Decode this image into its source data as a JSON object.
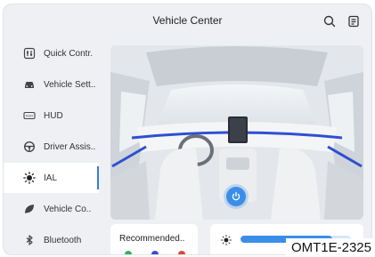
{
  "header": {
    "title": "Vehicle Center"
  },
  "sidebar": {
    "items": [
      {
        "label": "Quick Contr.",
        "icon": "quick-control-icon"
      },
      {
        "label": "Vehicle Sett..",
        "icon": "car-icon"
      },
      {
        "label": "HUD",
        "icon": "hud-icon"
      },
      {
        "label": "Driver Assis..",
        "icon": "steering-wheel-icon"
      },
      {
        "label": "IAL",
        "icon": "ambient-light-icon",
        "active": true
      },
      {
        "label": "Vehicle Co..",
        "icon": "leaf-icon"
      },
      {
        "label": "Bluetooth",
        "icon": "bluetooth-icon"
      }
    ]
  },
  "cards": {
    "recommended_label": "Recommended..",
    "brightness_level": 0.83
  },
  "figure_code": "OMT1E-2325",
  "colors": {
    "accent": "#3b8ee8",
    "ambient": "#2f4fd1"
  }
}
